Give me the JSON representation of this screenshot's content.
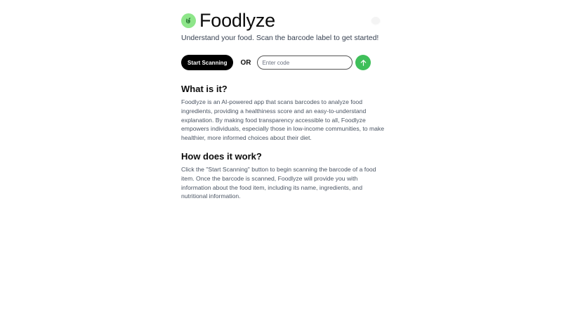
{
  "app": {
    "title": "Foodlyze",
    "tagline": "Understand your food. Scan the barcode label to get started!",
    "logo_icon": "leaf-icon",
    "logo_color": "#8ee68a"
  },
  "scan": {
    "start_label": "Start Scanning",
    "or_label": "OR",
    "code_placeholder": "Enter code",
    "code_value": "",
    "submit_icon": "arrow-up-icon",
    "submit_color": "#3fbf5a"
  },
  "sections": [
    {
      "heading": "What is it?",
      "body": "Foodlyze is an AI-powered app that scans barcodes to analyze food ingredients, providing a healthiness score and an easy-to-understand explanation. By making food transparency accessible to all, Foodlyze empowers individuals, especially those in low-income communities, to make healthier, more informed choices about their diet."
    },
    {
      "heading": "How does it work?",
      "body": "Click the \"Start Scanning\" button to begin scanning the barcode of a food item. Once the barcode is scanned, Foodlyze will provide you with information about the food item, including its name, ingredients, and nutritional information."
    }
  ]
}
